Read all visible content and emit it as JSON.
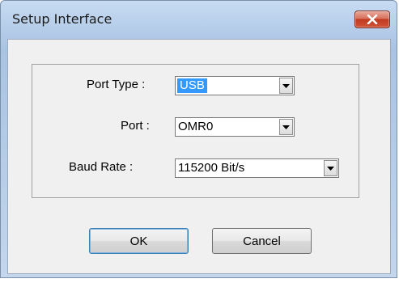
{
  "window": {
    "title": "Setup Interface"
  },
  "icons": {
    "close": "close-icon",
    "dropdown": "chevron-down-icon"
  },
  "form": {
    "port_type": {
      "label": "Port Type :",
      "value": "USB"
    },
    "port": {
      "label": "Port :",
      "value": "OMR0"
    },
    "baud_rate": {
      "label": "Baud Rate :",
      "value": "115200 Bit/s"
    }
  },
  "buttons": {
    "ok": "OK",
    "cancel": "Cancel"
  },
  "colors": {
    "selection": "#3399ff",
    "close_button": "#c0391f"
  }
}
